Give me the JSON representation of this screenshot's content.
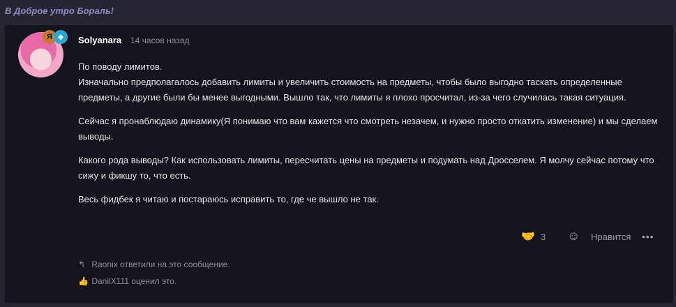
{
  "thread": {
    "title": "В Доброе утро Бораль!"
  },
  "post": {
    "author": "Solyanara",
    "time": "14 часов назад",
    "badges": [
      "Я",
      "◈"
    ],
    "paragraphs": [
      "По поводу лимитов.\nИзначально предполагалось добавить лимиты и увеличить стоимость на предметы, чтобы было выгодно таскать определенные предметы, а другие были бы менее выгодными. Вышло так, что лимиты я плохо просчитал, из-за чего случилась такая ситуация.",
      "Сейчас я пронаблюдаю динамику(Я понимаю что вам кажется что смотреть незачем, и нужно просто откатить изменение) и мы сделаем выводы.",
      "Какого рода выводы? Как использовать лимиты, пересчитать цены на предметы и подумать над Дросселем. Я молчу сейчас потому что сижу и фикшу то, что есть.",
      "Весь фидбек я читаю и постараюсь исправить то, где че вышло не так."
    ],
    "reaction_count": "3",
    "like_label": "Нравится",
    "more_label": "•••",
    "replies_text": "Raonix ответили на это сообщение.",
    "rated_text": "DanilX111 оценил это."
  }
}
